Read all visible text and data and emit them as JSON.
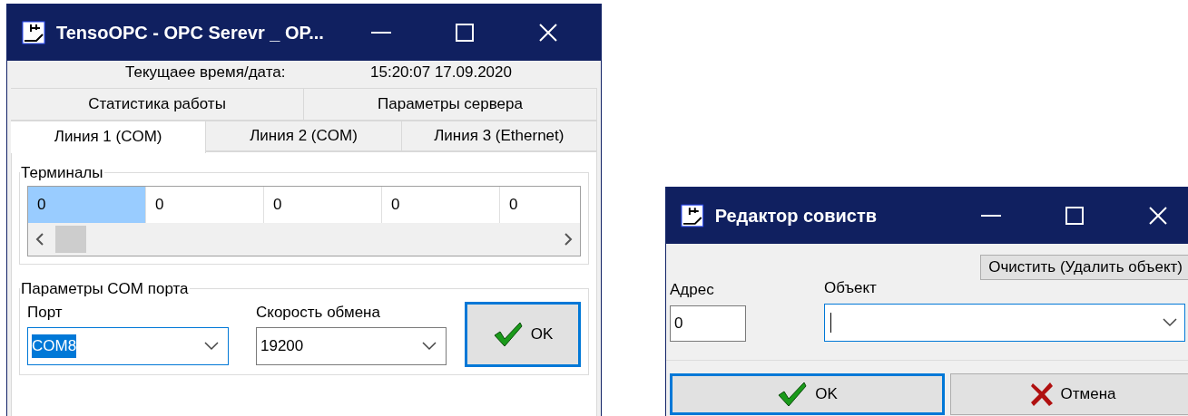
{
  "main_window": {
    "title": "TensoOPC -  OPC Serevr _ OP...",
    "clock": {
      "label": "Текущаее время/дата:",
      "value": "15:20:07 17.09.2020"
    },
    "tab_rows": [
      [
        {
          "label": "Статистика работы",
          "selected": false
        },
        {
          "label": "Параметры сервера",
          "selected": false
        }
      ],
      [
        {
          "label": "Линия 1 (COM)",
          "selected": true
        },
        {
          "label": "Линия 2 (COM)",
          "selected": false
        },
        {
          "label": "Линия 3 (Ethernet)",
          "selected": false
        }
      ]
    ],
    "terminals": {
      "title": "Терминалы",
      "cells": [
        {
          "text": "0",
          "selected": true
        },
        {
          "text": "0",
          "selected": false
        },
        {
          "text": "0",
          "selected": false
        },
        {
          "text": "0",
          "selected": false
        },
        {
          "text": "0",
          "selected": false
        }
      ]
    },
    "com_params": {
      "title": "Параметры COM порта",
      "port": {
        "label": "Порт",
        "value": "COM8",
        "focused": true
      },
      "speed": {
        "label": "Скорость обмена",
        "value": "19200",
        "focused": false
      },
      "ok_button": "OK"
    }
  },
  "editor_window": {
    "title": "Редактор совиств",
    "clear_button": "Очистить (Удалить объект)",
    "address": {
      "label": "Адрес",
      "value": "0"
    },
    "object": {
      "label": "Объект"
    },
    "buttons": [
      {
        "label": "OK",
        "kind": "ok"
      },
      {
        "label": "Отмена",
        "kind": "cancel"
      }
    ]
  }
}
